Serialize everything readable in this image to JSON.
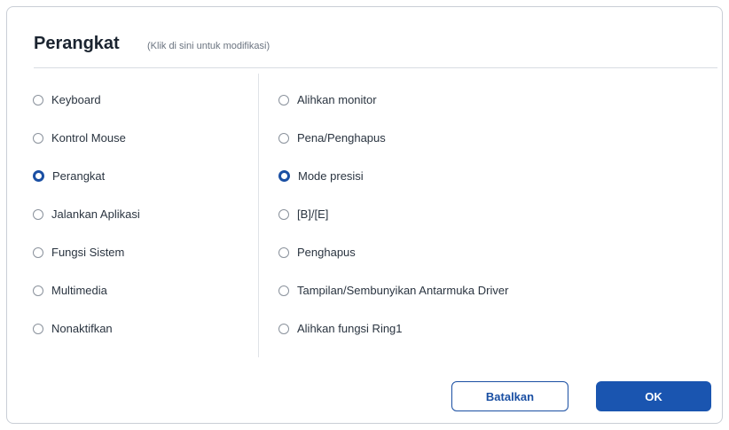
{
  "dialog": {
    "title": "Perangkat",
    "hint": "(Klik di sini untuk modifikasi)"
  },
  "left_options": [
    {
      "label": "Keyboard",
      "selected": false
    },
    {
      "label": "Kontrol Mouse",
      "selected": false
    },
    {
      "label": "Perangkat",
      "selected": true
    },
    {
      "label": "Jalankan Aplikasi",
      "selected": false
    },
    {
      "label": "Fungsi Sistem",
      "selected": false
    },
    {
      "label": "Multimedia",
      "selected": false
    },
    {
      "label": "Nonaktifkan",
      "selected": false
    }
  ],
  "right_options": [
    {
      "label": "Alihkan monitor",
      "selected": false
    },
    {
      "label": "Pena/Penghapus",
      "selected": false
    },
    {
      "label": "Mode presisi",
      "selected": true
    },
    {
      "label": "[B]/[E]",
      "selected": false
    },
    {
      "label": "Penghapus",
      "selected": false
    },
    {
      "label": "Tampilan/Sembunyikan Antarmuka Driver",
      "selected": false
    },
    {
      "label": "Alihkan fungsi Ring1",
      "selected": false
    }
  ],
  "buttons": {
    "cancel_label": "Batalkan",
    "ok_label": "OK"
  },
  "colors": {
    "accent": "#1a55b0",
    "border": "#c9ced6"
  }
}
